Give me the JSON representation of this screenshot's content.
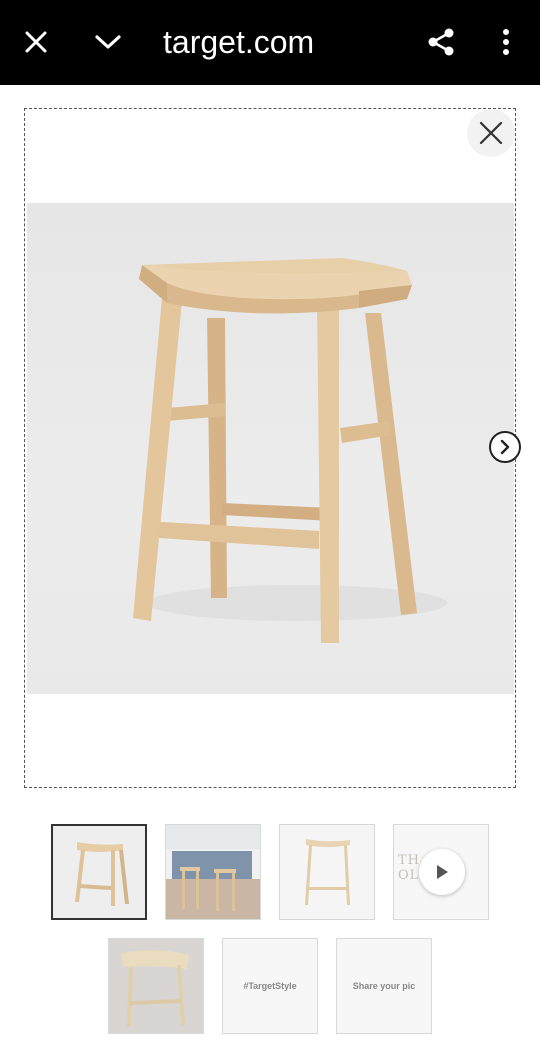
{
  "browser": {
    "title": "target.com",
    "icons": [
      "close-icon",
      "chevron-down-icon",
      "share-icon",
      "more-vert-icon"
    ]
  },
  "viewer": {
    "icons": [
      "close-icon",
      "chevron-right-icon"
    ],
    "colors": {
      "wood": "#e3c49a",
      "wood_dark": "#caa67a",
      "background": "#e8e8e8"
    }
  },
  "thumbnails": [
    {
      "kind": "stool",
      "selected": true
    },
    {
      "kind": "kitchen-scene",
      "selected": false
    },
    {
      "kind": "stool-outline",
      "selected": false
    },
    {
      "kind": "video",
      "selected": false,
      "overlay_text": "TH",
      "overlay_text_right": "OLD"
    },
    {
      "kind": "stool-angle",
      "selected": false
    },
    {
      "kind": "text",
      "label": "#TargetStyle"
    },
    {
      "kind": "text",
      "label": "Share your pic"
    }
  ]
}
